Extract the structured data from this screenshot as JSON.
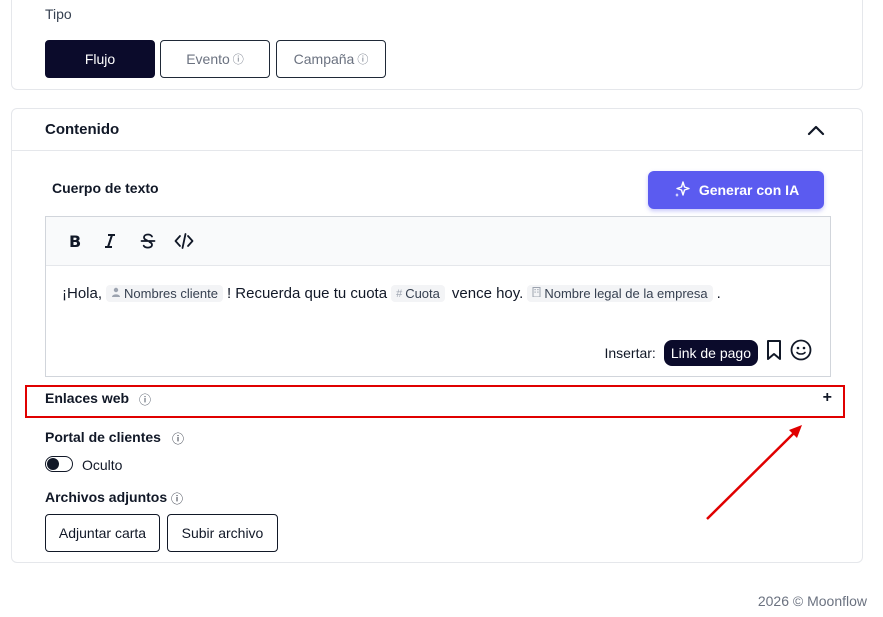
{
  "tipo": {
    "label": "Tipo",
    "options": [
      {
        "label": "Flujo",
        "active": true,
        "info": false
      },
      {
        "label": "Evento",
        "active": false,
        "info": true
      },
      {
        "label": "Campaña",
        "active": false,
        "info": true
      }
    ]
  },
  "contenido": {
    "title": "Contenido",
    "body_label": "Cuerpo de texto",
    "generate_button": "Generar con IA",
    "editor": {
      "text_parts": {
        "greeting": "¡Hola,",
        "chip_client": "Nombres cliente",
        "middle": "! Recuerda que tu cuota",
        "chip_cuota": "Cuota",
        "after_cuota": "vence hoy.",
        "chip_company": "Nombre legal de la empresa",
        "end": "."
      },
      "insert_label": "Insertar:",
      "insert_pill": "Link de pago"
    },
    "enlaces_web": "Enlaces web",
    "portal": {
      "label": "Portal de clientes",
      "toggle_state": "Oculto"
    },
    "adjuntos": {
      "label": "Archivos adjuntos",
      "buttons": [
        "Adjuntar carta",
        "Subir archivo"
      ]
    }
  },
  "footer": "2026 © Moonflow",
  "colors": {
    "primary_dark": "#0b0b2b",
    "accent": "#5b5bf0",
    "highlight": "#e00000"
  }
}
